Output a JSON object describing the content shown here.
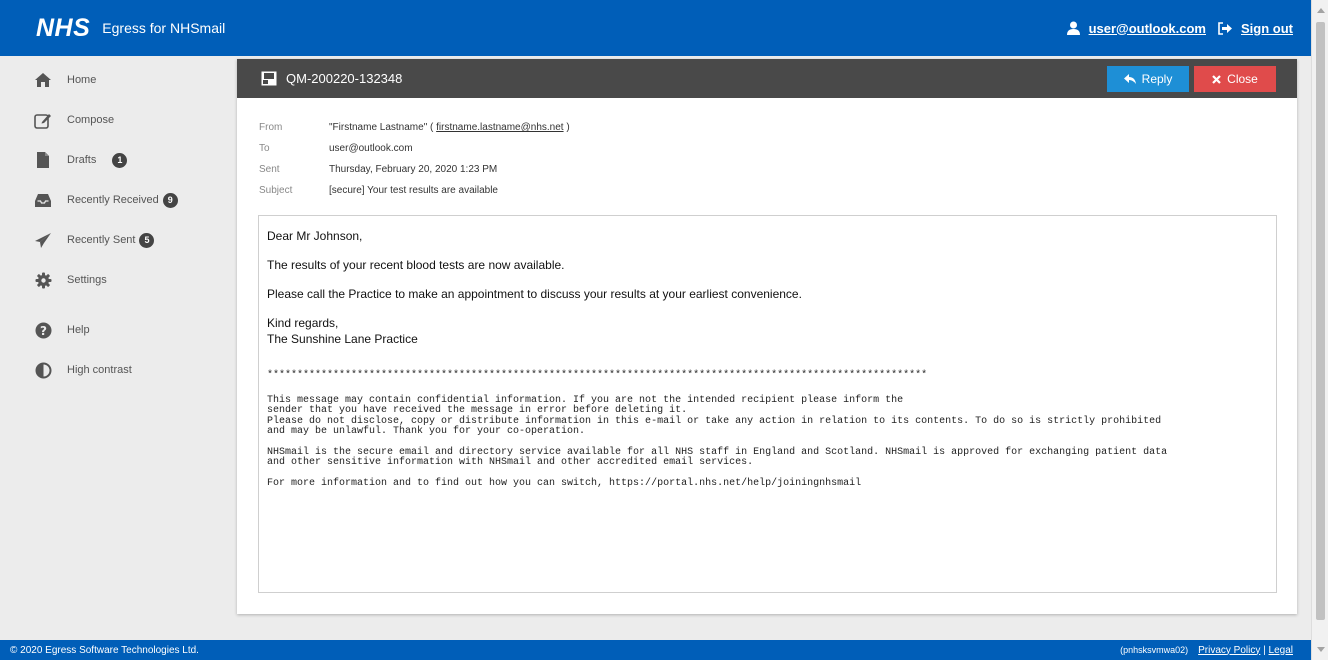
{
  "header": {
    "logo": "NHS",
    "app_title": "Egress for NHSmail",
    "user": "user@outlook.com",
    "sign_out": "Sign out"
  },
  "sidebar": {
    "items": [
      {
        "label": "Home",
        "icon": "home-icon"
      },
      {
        "label": "Compose",
        "icon": "compose-icon"
      },
      {
        "label": "Drafts",
        "icon": "drafts-icon",
        "badge": "1"
      },
      {
        "label": "Recently Received",
        "icon": "inbox-icon",
        "badge": "9"
      },
      {
        "label": "Recently Sent",
        "icon": "send-icon",
        "badge": "5"
      },
      {
        "label": "Settings",
        "icon": "gear-icon"
      },
      {
        "label": "Help",
        "icon": "help-icon"
      },
      {
        "label": "High contrast",
        "icon": "contrast-icon"
      }
    ]
  },
  "message": {
    "id": "QM-200220-132348",
    "reply_label": "Reply",
    "close_label": "Close",
    "from_label": "From",
    "from_name": "\"Firstname Lastname\" (",
    "from_email": "firstname.lastname@nhs.net",
    "from_close": ")",
    "to_label": "To",
    "to": "user@outlook.com",
    "sent_label": "Sent",
    "sent": "Thursday, February 20, 2020 1:23 PM",
    "subject_label": "Subject",
    "subject": "[secure] Your test results are available",
    "body": {
      "greeting": "Dear Mr Johnson,",
      "line1": "The results of your recent blood tests are now available.",
      "line2": "Please call the Practice to make an appointment to discuss your results at your earliest convenience.",
      "signoff1": "Kind regards,",
      "signoff2": "The Sunshine Lane Practice",
      "stars": "**************************************************************************************************************",
      "disclaimer1": "This message may contain confidential information. If you are not the intended recipient please inform the\nsender that you have received the message in error before deleting it.\nPlease do not disclose, copy or distribute information in this e-mail or take any action in relation to its contents. To do so is strictly prohibited\nand may be unlawful. Thank you for your co-operation.",
      "disclaimer2": "NHSmail is the secure email and directory service available for all NHS staff in England and Scotland. NHSmail is approved for exchanging patient data\nand other sensitive information with NHSmail and other accredited email services.",
      "disclaimer3": "For more information and to find out how you can switch, https://portal.nhs.net/help/joiningnhsmail"
    }
  },
  "footer": {
    "copyright": "© 2020 Egress Software Technologies Ltd.",
    "server": "(pnhsksvmwa02)",
    "privacy": "Privacy Policy",
    "separator": "|",
    "legal": "Legal"
  },
  "colors": {
    "nhs_blue": "#005eb8",
    "reply_button": "#1e8fd6",
    "close_button": "#e04b4b",
    "panel_header": "#494949"
  }
}
